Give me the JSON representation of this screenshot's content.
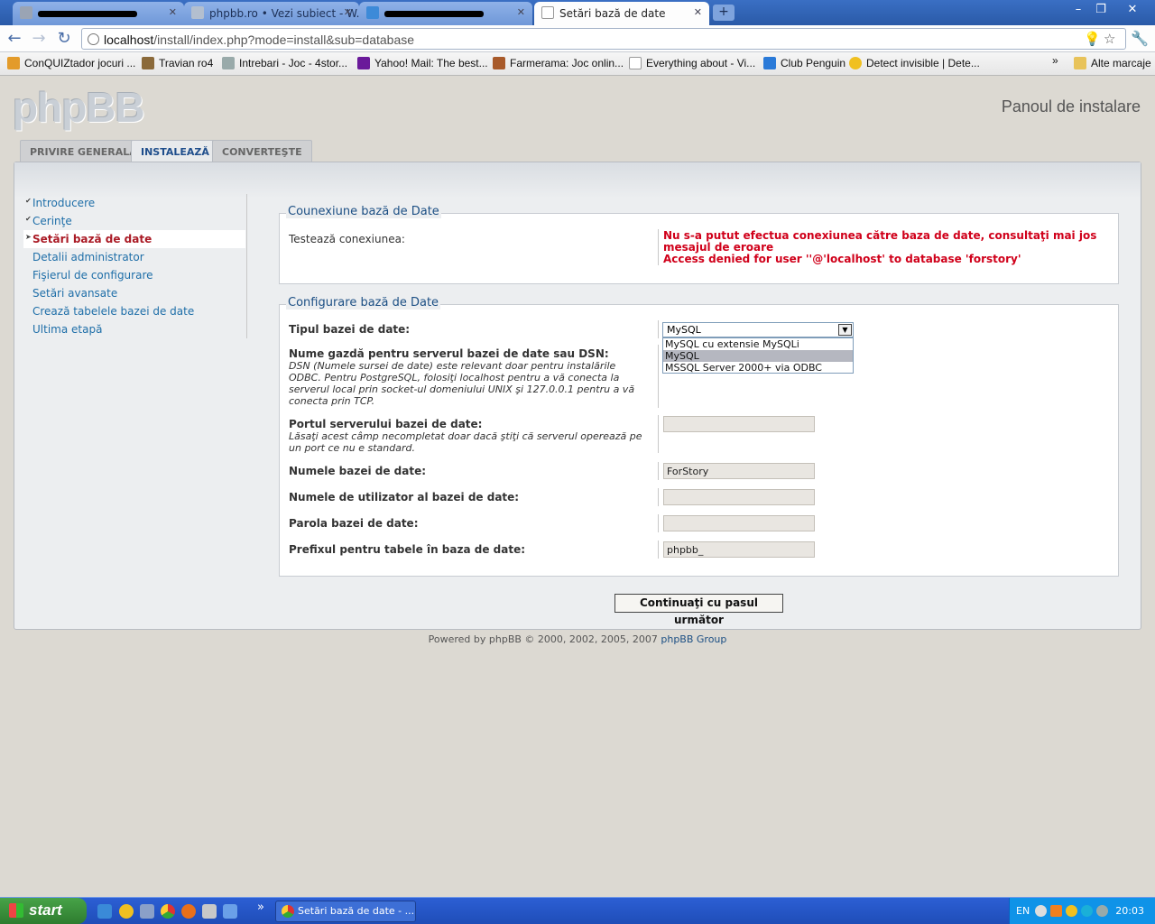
{
  "browser": {
    "tabs": [
      {
        "label": "",
        "redacted": true
      },
      {
        "label": "phpbb.ro • Vezi subiect - W...",
        "redacted": false
      },
      {
        "label": "",
        "redacted": true
      },
      {
        "label": "Setări bază de date",
        "redacted": false
      }
    ],
    "url_host": "localhost",
    "url_path": "/install/index.php?mode=install&sub=database",
    "bookmarks": [
      "ConQUIZtador jocuri ...",
      "Travian ro4",
      "Intrebari - Joc - 4stor...",
      "Yahoo! Mail: The best...",
      "Farmerama: Joc onlin...",
      "Everything about - Vi...",
      "Club Penguin",
      "Detect invisible | Dete..."
    ],
    "other_bookmarks": "Alte marcaje",
    "chevron": "»"
  },
  "header": {
    "logo": "phpBB",
    "panel_title": "Panoul de instalare"
  },
  "tabs": [
    {
      "label": "PRIVIRE GENERALĂ"
    },
    {
      "label": "INSTALEAZĂ"
    },
    {
      "label": "CONVERTEŞTE"
    }
  ],
  "menu": {
    "items": [
      {
        "label": "Introducere"
      },
      {
        "label": "Cerinţe"
      },
      {
        "label": "Setări bază de date"
      },
      {
        "label": "Detalii administrator"
      },
      {
        "label": "Fişierul de configurare"
      },
      {
        "label": "Setări avansate"
      },
      {
        "label": "Crează tabelele bazei de date"
      },
      {
        "label": "Ultima etapă"
      }
    ]
  },
  "connection": {
    "legend": "Counexiune bază de Date",
    "test_label": "Testează conexiunea:",
    "error_line1": "Nu s-a putut efectua conexiunea către baza de date, consultaţi mai jos",
    "error_line2": "mesajul de eroare",
    "error_line3": "Access denied for user ''@'localhost' to database 'forstory'"
  },
  "config": {
    "legend": "Configurare bază de Date",
    "dbms_label": "Tipul bazei de date:",
    "dbms_value": "MySQL",
    "dbms_options": [
      "MySQL cu extensie MySQLi",
      "MySQL",
      "MSSQL Server 2000+ via ODBC"
    ],
    "host_label": "Nume gazdă pentru serverul bazei de date sau DSN:",
    "host_desc_1": "DSN (Numele sursei de date) este relevant doar pentru instalările",
    "host_desc_2": "ODBC. Pentru PostgreSQL, folosiţi localhost pentru a vă conecta la",
    "host_desc_3": "serverul local prin socket-ul domeniului UNIX şi 127.0.0.1 pentru a vă",
    "host_desc_4": "conecta prin TCP.",
    "port_label": "Portul serverului bazei de date:",
    "port_desc_1": "Lăsaţi acest câmp necompletat doar dacă ştiţi că serverul operează pe",
    "port_desc_2": "un port ce nu e standard.",
    "port_value": "",
    "dbname_label": "Numele bazei de date:",
    "dbname_value": "ForStory",
    "dbuser_label": "Numele de utilizator al bazei de date:",
    "dbuser_value": "",
    "dbpass_label": "Parola bazei de date:",
    "dbpass_value": "",
    "prefix_label": "Prefixul pentru tabele în baza de date:",
    "prefix_value": "phpbb_"
  },
  "submit_label": "Continuaţi cu pasul următor",
  "footer": {
    "text": "Powered by phpBB © 2000, 2002, 2005, 2007",
    "link": "phpBB Group"
  },
  "taskbar": {
    "start": "start",
    "task_label": "Setări bază de date - ...",
    "lang": "EN",
    "clock": "20:03",
    "chevron": "»"
  }
}
